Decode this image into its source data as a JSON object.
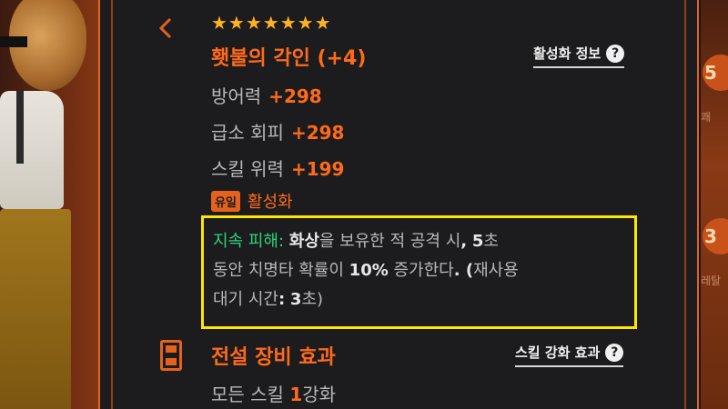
{
  "item": {
    "stars": "★★★★★★★",
    "title": "횃불의 각인 (+4)",
    "info_link_label": "활성화 정보",
    "stats": [
      {
        "label": "방어력",
        "value": "+298"
      },
      {
        "label": "급소 회피",
        "value": "+298"
      },
      {
        "label": "스킬 위력",
        "value": "+199"
      }
    ],
    "unique_badge": "유일",
    "activate_label": "활성화"
  },
  "effect": {
    "name": "지속 피해:",
    "keyword": "화상",
    "part1": "을 보유한 적 공격 시",
    "comma": ",",
    "num1": "5",
    "part2": "초",
    "line2_prefix": "동안 치명타 확률이",
    "pct": "10%",
    "line2_suffix": "증가한다",
    "dot_paren": ". (",
    "cooldown_label": "재사용",
    "line3_prefix": "대기 시간",
    "colon": ":",
    "num2": "3",
    "line3_suffix": "초)"
  },
  "legendary": {
    "title": "전설 장비 효과",
    "skill_link_label": "스킬 강화 효과",
    "effect_prefix": "모든 스킬",
    "effect_value": "1",
    "effect_suffix": "강화"
  },
  "side": {
    "badge_top": "5",
    "badge_mid": "3",
    "text_top": "쾌",
    "text_mid": "레탈"
  },
  "colors": {
    "accent": "#ff6a1a",
    "stars": "#ffb21e",
    "highlight_box": "#ffe600",
    "effect_green": "#2ad37a",
    "panel_bg": "#1c1c1f"
  },
  "icons": [
    "back-chevron-icon",
    "question-icon",
    "legendary-hourglass-icon"
  ]
}
